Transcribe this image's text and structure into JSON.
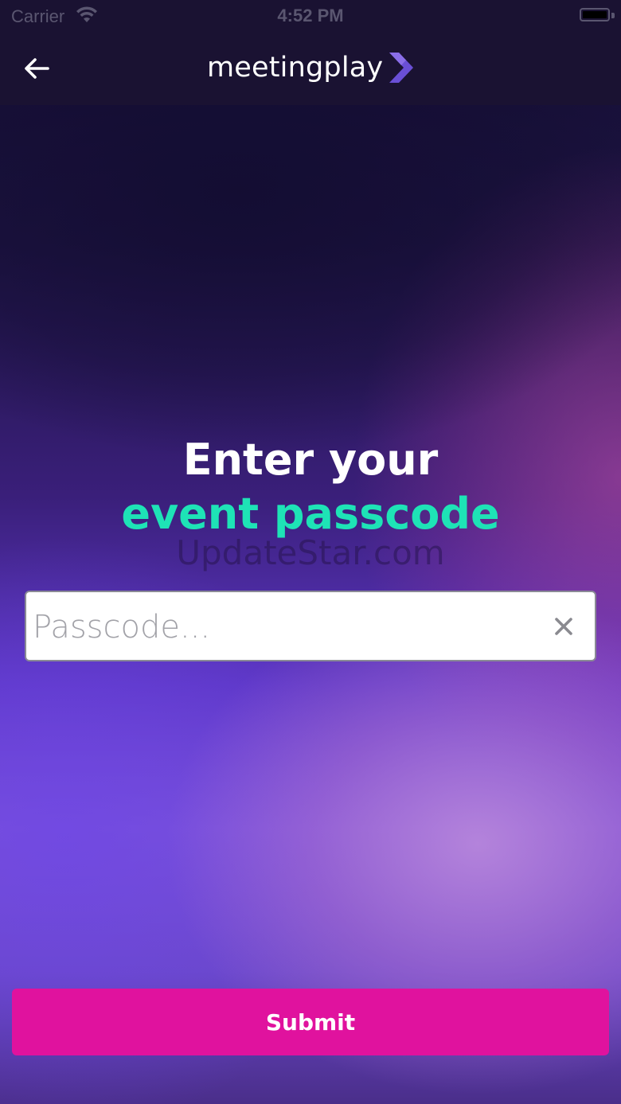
{
  "status_bar": {
    "carrier": "Carrier",
    "time": "4:52 PM",
    "icons": [
      "wifi-icon",
      "battery-icon"
    ]
  },
  "nav": {
    "back_icon": "arrow-left-icon",
    "logo_text": "meetingplay",
    "logo_icon": "chevron-right-icon"
  },
  "heading": {
    "line1": "Enter your",
    "line2": "event passcode"
  },
  "watermark": "UpdateStar.com",
  "passcode": {
    "value": "",
    "placeholder": "Passcode...",
    "clear_icon": "close-icon"
  },
  "submit": {
    "label": "Submit"
  },
  "colors": {
    "accent_green": "#1ee3b6",
    "button_pink": "#e0129e",
    "logo_purple": "#6a4fd6",
    "nav_bg": "#1a1232"
  }
}
